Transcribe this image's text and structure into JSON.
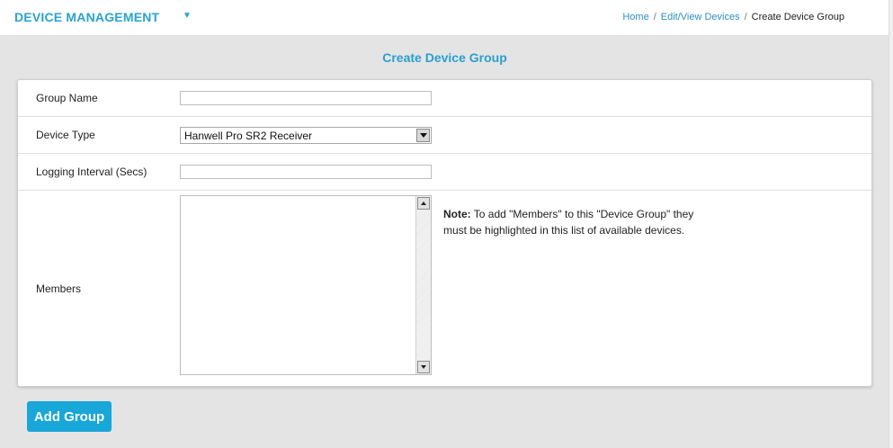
{
  "header": {
    "app_title": "DEVICE MANAGEMENT",
    "menu_toggle_icon": "caret-down-icon",
    "breadcrumb": [
      {
        "label": "Home",
        "link": true
      },
      {
        "label": "Edit/View Devices",
        "link": true
      },
      {
        "label": "Create Device Group",
        "link": false
      }
    ],
    "separator": "/"
  },
  "page_title": "Create Device Group",
  "form": {
    "group_name": {
      "label": "Group Name",
      "value": ""
    },
    "device_type": {
      "label": "Device Type",
      "value": "Hanwell Pro SR2 Receiver"
    },
    "logging_interval": {
      "label": "Logging Interval (Secs)",
      "value": ""
    },
    "members": {
      "label": "Members",
      "options": []
    },
    "note": {
      "prefix": "Note:",
      "text": " To add \"Members\" to this \"Device Group\" they must be highlighted in this list of available devices."
    }
  },
  "actions": {
    "add_group_label": "Add Group"
  },
  "colors": {
    "accent": "#29a3cc",
    "button": "#19a6d8",
    "background": "#e4e4e4"
  }
}
